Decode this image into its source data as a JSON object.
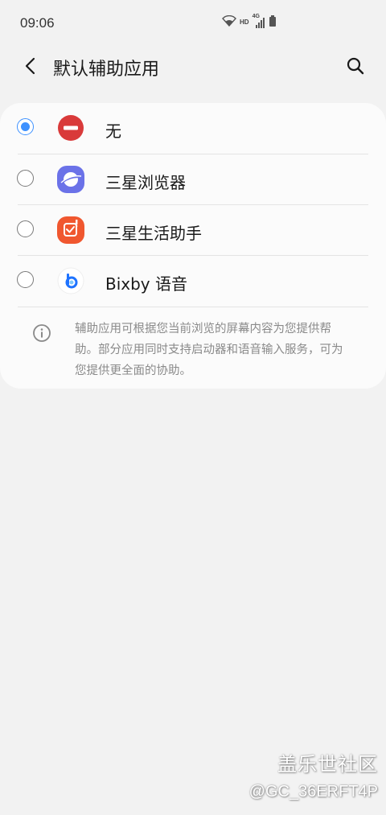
{
  "status_bar": {
    "time": "09:06",
    "hd_label": "HD",
    "network_label": "4G"
  },
  "header": {
    "title": "默认辅助应用"
  },
  "options": [
    {
      "label": "无",
      "icon": "none-icon",
      "selected": true
    },
    {
      "label": "三星浏览器",
      "icon": "samsung-internet-icon",
      "selected": false
    },
    {
      "label": "三星生活助手",
      "icon": "samsung-life-assistant-icon",
      "selected": false
    },
    {
      "label": "Bixby 语音",
      "icon": "bixby-voice-icon",
      "selected": false
    }
  ],
  "info": {
    "text": "辅助应用可根据您当前浏览的屏幕内容为您提供帮助。部分应用同时支持启动器和语音输入服务，可为您提供更全面的协助。"
  },
  "watermark": {
    "title": "盖乐世社区",
    "user": "@GC_36ERFT4P"
  },
  "colors": {
    "accent": "#3e91ff",
    "none_icon": "#d93a3a",
    "browser_icon": "#6b72e8",
    "life_assistant_icon": "#f0572f",
    "bixby_icon": "#1e73ff"
  }
}
